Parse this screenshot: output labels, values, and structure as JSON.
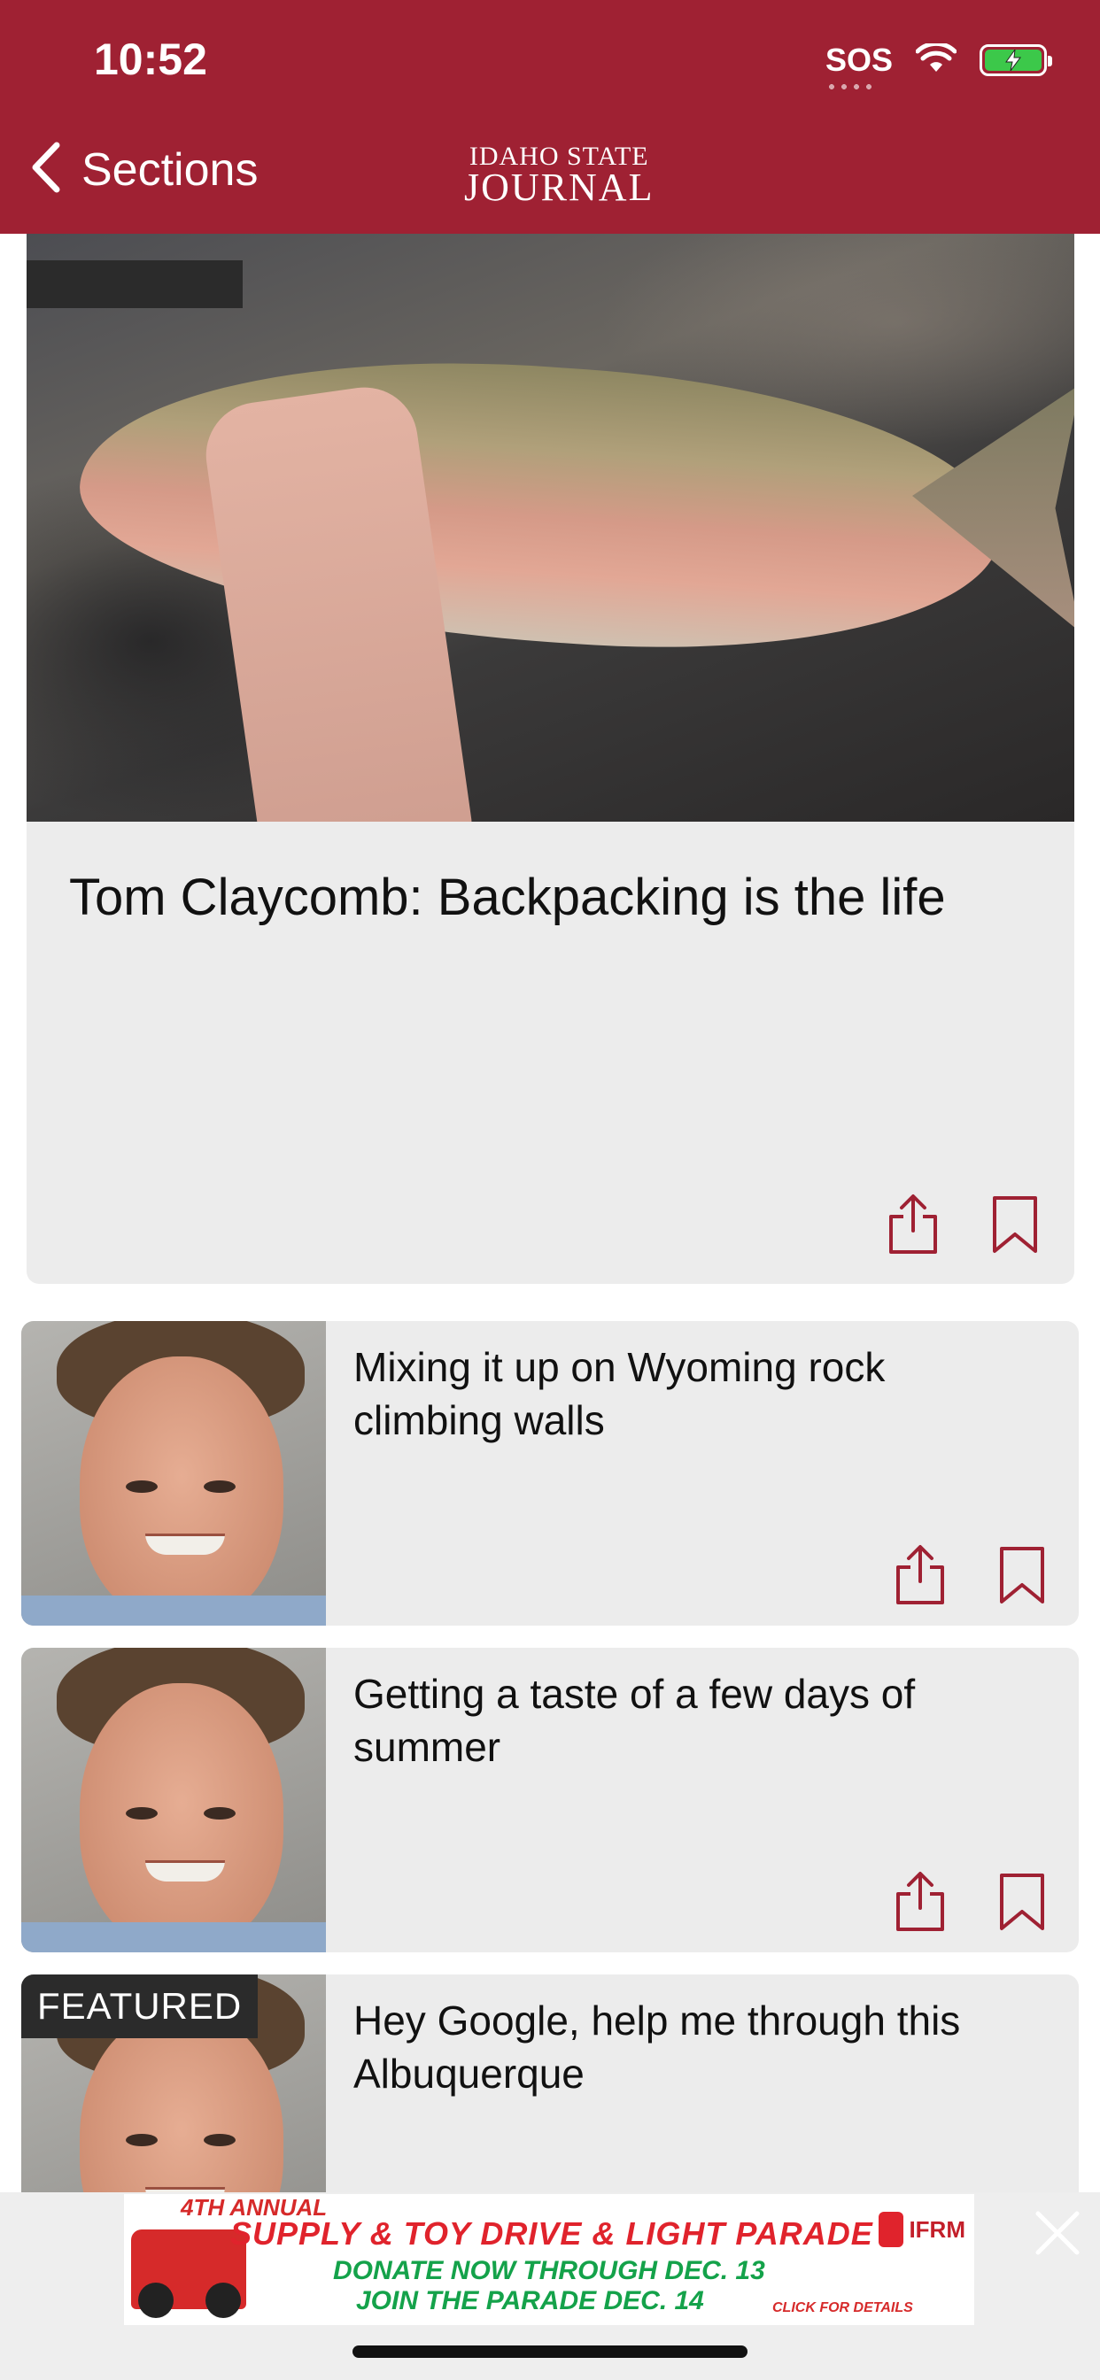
{
  "status": {
    "time": "10:52",
    "sos": "SOS"
  },
  "nav": {
    "back_label": "Sections",
    "logo_line1": "Idaho State",
    "logo_line2": "Journal"
  },
  "featured_article": {
    "title": "Tom Claycomb: Backpacking is the life"
  },
  "articles": [
    {
      "title": "Mixing it up on Wyoming rock climbing walls"
    },
    {
      "title": "Getting a taste of a few days of summer"
    },
    {
      "title": "Hey Google, help me through this Albuquerque",
      "badge": "FEATURED"
    }
  ],
  "ad": {
    "line1": "4TH ANNUAL",
    "line2": "SUPPLY & TOY DRIVE & LIGHT PARADE",
    "line3": "DONATE NOW THROUGH DEC. 13",
    "line4": "JOIN THE PARADE DEC. 14",
    "cta": "CLICK FOR DETAILS",
    "logo_text": "IFRM"
  },
  "colors": {
    "brand": "#9f2133",
    "card_bg": "#ececec",
    "icon": "#9f2133"
  }
}
